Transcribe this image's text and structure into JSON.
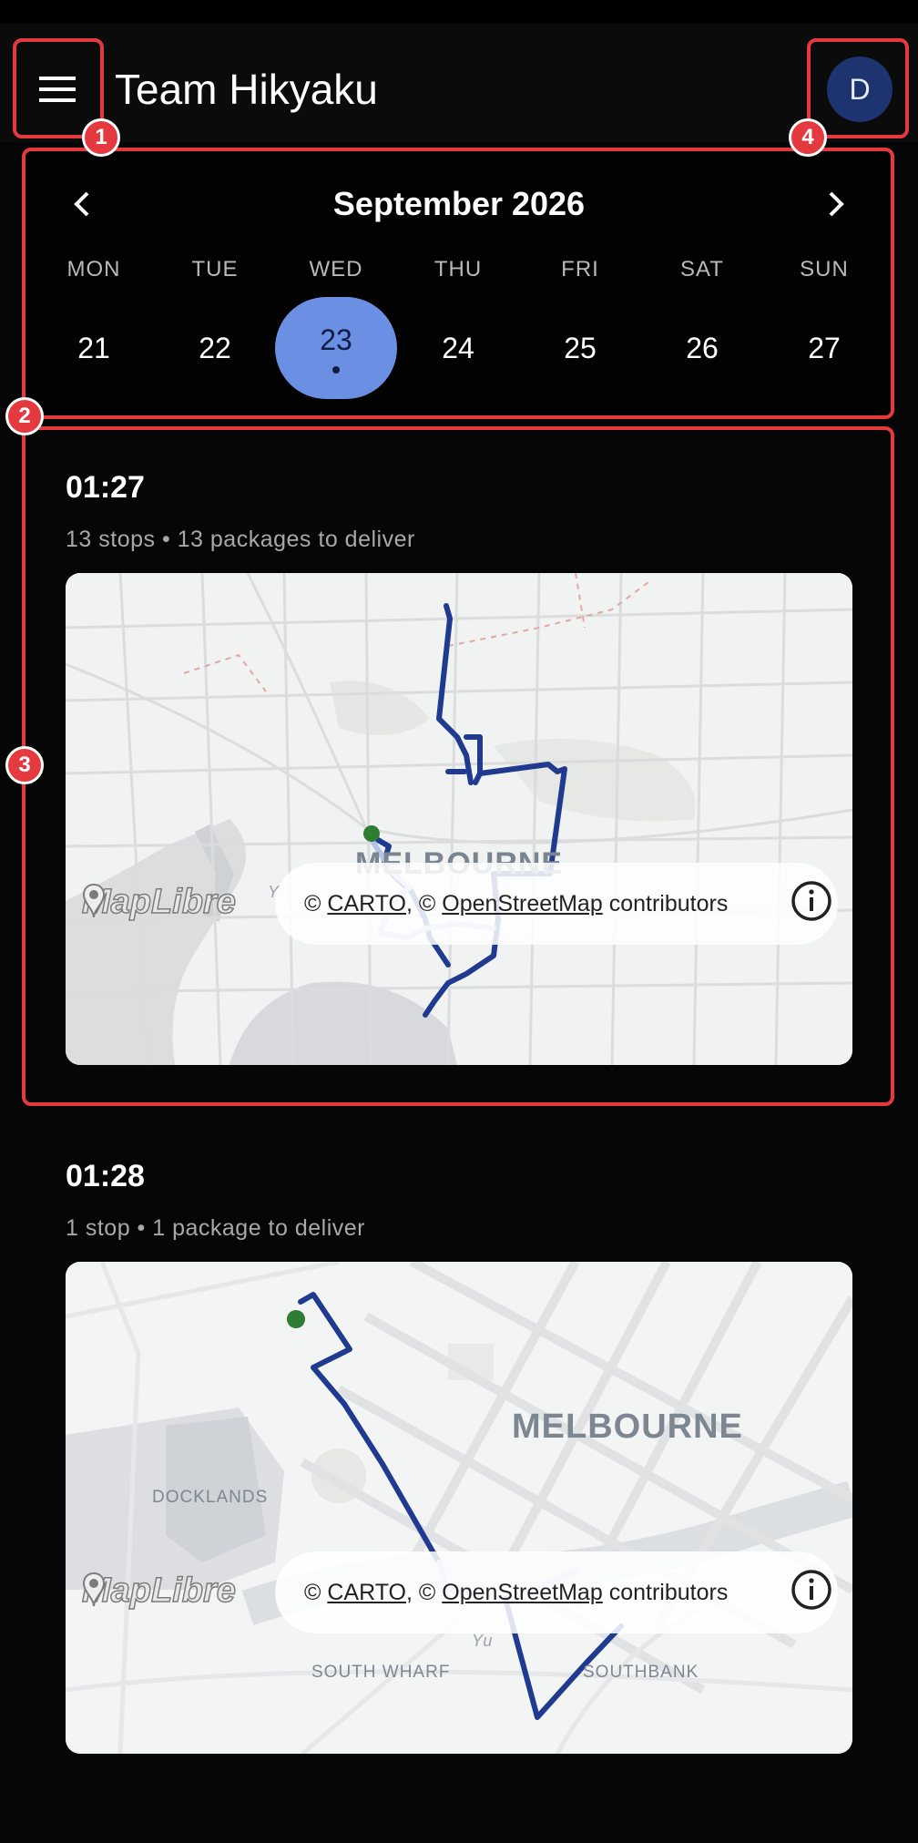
{
  "app": {
    "title": "Team Hikyaku",
    "avatar_initial": "D"
  },
  "icons": {
    "menu": "hamburger-menu-icon",
    "prev": "chevron-left-icon",
    "next": "chevron-right-icon",
    "info": "info-icon",
    "maplibre": "maplibre-pin-icon"
  },
  "calendar": {
    "month": "September 2026",
    "weekdays": [
      "MON",
      "TUE",
      "WED",
      "THU",
      "FRI",
      "SAT",
      "SUN"
    ],
    "days": [
      "21",
      "22",
      "23",
      "24",
      "25",
      "26",
      "27"
    ],
    "selected_day": "23",
    "selected_color": "#6b8fe2"
  },
  "routes": [
    {
      "time": "01:27",
      "summary": "13 stops • 13 packages to deliver",
      "map_label": "MELBOURNE",
      "river_label": "Y"
    },
    {
      "time": "01:28",
      "summary": "1 stop • 1 package to deliver",
      "map_labels": {
        "city": "MELBOURNE",
        "docklands": "DOCKLANDS",
        "south_wharf": "SOUTH WHARF",
        "southbank": "SOUTHBANK",
        "river": "Yu"
      }
    }
  ],
  "map_attribution": {
    "copyright": "©",
    "carto": "CARTO",
    "separator": ", ©",
    "osm": "OpenStreetMap",
    "contributors": "contributors",
    "logo": "MapLibre"
  },
  "colors": {
    "route": "#1f3a8e",
    "start_marker": "#2e7d32",
    "highlight": "#e53940"
  },
  "annotations": [
    "1",
    "2",
    "3",
    "4"
  ]
}
